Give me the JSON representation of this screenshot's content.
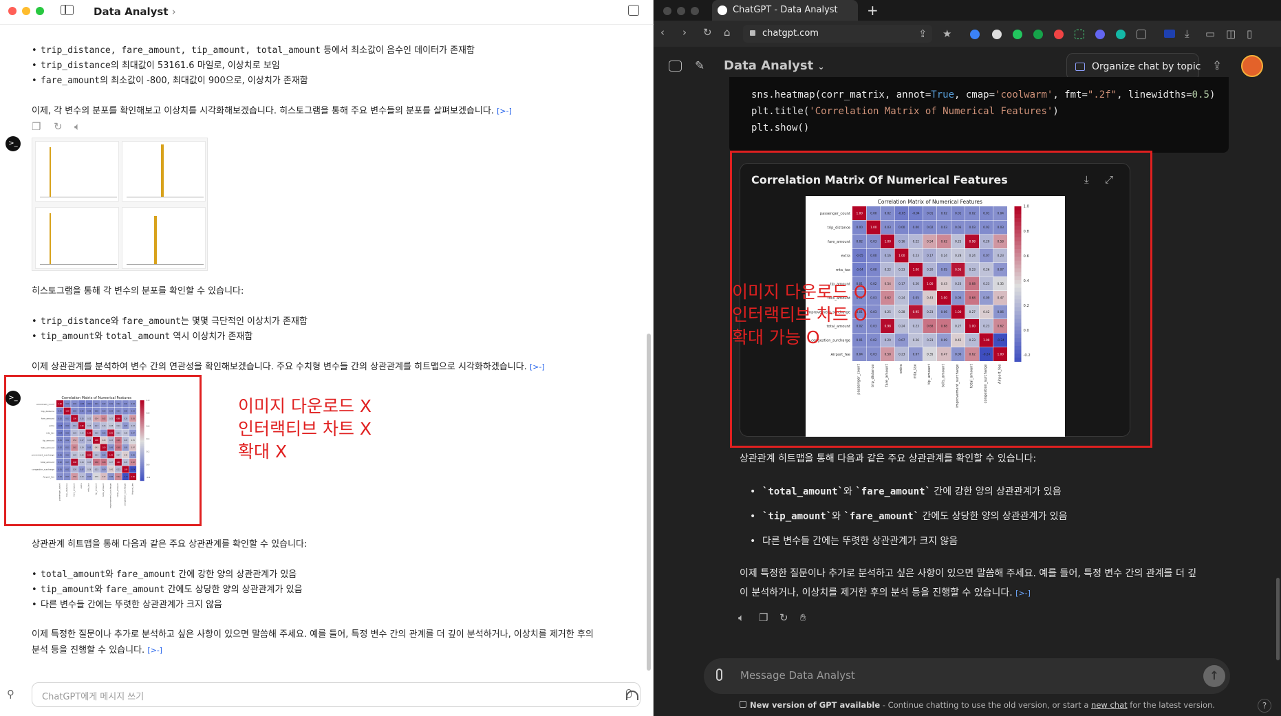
{
  "left": {
    "title": "Data Analyst",
    "title_chevron": "›",
    "bullets_top": [
      {
        "code": "trip_distance, fare_amount, tip_amount, total_amount",
        "text": " 등에서 최소값이 음수인 데이터가 존재함"
      },
      {
        "code": "trip_distance",
        "text": "의 최대값이 53161.6 마일로, 이상치로 보임"
      },
      {
        "code": "fare_amount",
        "text": "의 최소값이 -800, 최대값이 900으로, 이상치가 존재함"
      }
    ],
    "para1": "이제, 각 변수의 분포를 확인해보고 이상치를 시각화해보겠습니다. 히스토그램을 통해 주요 변수들의 분포를 살펴보겠습니다.",
    "cite": "[>-]",
    "hist_caption": "히스토그램을 통해 각 변수의 분포를 확인할 수 있습니다:",
    "bullets_mid": [
      {
        "code": "trip_distance",
        "mid": "와 ",
        "code2": "fare_amount",
        "text": "는 몇몇 극단적인 이상치가 존재함"
      },
      {
        "code": "tip_amount",
        "mid": "와 ",
        "code2": "total_amount",
        "text": " 역시 이상치가 존재함"
      }
    ],
    "para2": "이제 상관관계를 분석하여 변수 간의 연관성을 확인해보겠습니다. 주요 수치형 변수들 간의 상관관계를 히트맵으로 시각화하겠습니다.",
    "annotation": [
      "이미지 다운로드 X",
      "인터랙티브 차트 X",
      "확대 X"
    ],
    "heatmap_caption": "상관관계 히트맵을 통해 다음과 같은 주요 상관관계를 확인할 수 있습니다:",
    "bullets_bottom": [
      {
        "code": "total_amount",
        "mid": "와 ",
        "code2": "fare_amount",
        "text": " 간에 강한 양의 상관관계가 있음"
      },
      {
        "code": "tip_amount",
        "mid": "와 ",
        "code2": "fare_amount",
        "text": " 간에도 상당한 양의 상관관계가 있음"
      },
      {
        "code": "",
        "mid": "",
        "code2": "",
        "text": "다른 변수들 간에는 뚜렷한 상관관계가 크지 않음"
      }
    ],
    "closing_1": "이제 특정한 질문이나 추가로 분석하고 싶은 사항이 있으면 말씀해 주세요. 예를 들어, 특정 변수 간의 관계를 더 깊이 분석하거나, 이상치를 제거한 후의",
    "closing_2": "분석 등을 진행할 수 있습니다.",
    "input_placeholder": "ChatGPT에게 메시지 쓰기",
    "avatar_glyph": ">_"
  },
  "right": {
    "tab_title": "ChatGPT - Data Analyst",
    "new_tab": "+",
    "url": "chatgpt.com",
    "header_title": "Data Analyst",
    "organize_label": "Organize chat by topic",
    "code_line1_pre": "sns.heatmap(corr_matrix, annot=",
    "code_line1_true": "True",
    "code_line1_mid": ", cmap=",
    "code_line1_cmap": "'coolwarm'",
    "code_line1_fmt_pre": ", fmt=",
    "code_line1_fmt": "\".2f\"",
    "code_line1_lw_pre": ", linewidths=",
    "code_line1_lw": "0.5",
    "code_line1_end": ")",
    "code_line2_pre": "plt.title(",
    "code_line2_str": "'Correlation Matrix of Numerical Features'",
    "code_line2_end": ")",
    "code_line3": "plt.show()",
    "card_title": "Correlation Matrix Of Numerical Features",
    "annotation": [
      "이미지 다운로드 O",
      "인터랙티브 차트 O",
      "확대 가능 O"
    ],
    "caption": "상관관계 히트맵을 통해 다음과 같은 주요 상관관계를 확인할 수 있습니다:",
    "bullets": [
      {
        "code": "`total_amount`",
        "mid": "와 ",
        "code2": "`fare_amount`",
        "text": " 간에 강한 양의 상관관계가 있음"
      },
      {
        "code": "`tip_amount`",
        "mid": "와 ",
        "code2": "`fare_amount`",
        "text": " 간에도 상당한 양의 상관관계가 있음"
      },
      {
        "code": "",
        "mid": "",
        "code2": "",
        "text": "다른 변수들 간에는 뚜렷한 상관관계가 크지 않음"
      }
    ],
    "closing_1": "이제 특정한 질문이나 추가로 분석하고 싶은 사항이 있으면 말씀해 주세요. 예를 들어, 특정 변수 간의 관계를 더 깊",
    "closing_2": "이 분석하거나, 이상치를 제거한 후의 분석 등을 진행할 수 있습니다.",
    "cite": "[>-]",
    "input_placeholder": "Message Data Analyst",
    "footer_bold": "New version of GPT available",
    "footer_text": " - Continue chatting to use the old version, or start a ",
    "footer_link": "new chat",
    "footer_end": " for the latest version.",
    "help": "?"
  },
  "heatmap": {
    "title": "Correlation Matrix of Numerical Features",
    "labels": [
      "passenger_count",
      "trip_distance",
      "fare_amount",
      "extra",
      "mta_tax",
      "tip_amount",
      "tolls_amount",
      "improvement_surcharge",
      "total_amount",
      "congestion_surcharge",
      "Airport_fee"
    ],
    "colorbar_ticks": [
      "1.0",
      "0.8",
      "0.6",
      "0.4",
      "0.2",
      "0.0",
      "-0.2"
    ],
    "matrix": [
      [
        1.0,
        -0.0,
        0.02,
        -0.05,
        -0.04,
        0.01,
        0.02,
        0.01,
        0.02,
        0.01,
        0.04
      ],
      [
        -0.0,
        1.0,
        0.03,
        0.0,
        -0.0,
        0.02,
        0.03,
        0.03,
        0.03,
        0.02,
        0.03
      ],
      [
        0.02,
        0.03,
        1.0,
        0.16,
        0.22,
        0.54,
        0.62,
        0.25,
        0.98,
        0.2,
        0.58
      ],
      [
        -0.05,
        0.0,
        0.16,
        1.0,
        0.23,
        0.17,
        0.24,
        0.28,
        0.24,
        0.07,
        0.23
      ],
      [
        -0.04,
        -0.0,
        0.22,
        0.23,
        1.0,
        0.2,
        0.05,
        0.95,
        0.23,
        0.26,
        0.07
      ],
      [
        0.01,
        0.02,
        0.54,
        0.17,
        0.2,
        1.0,
        0.43,
        0.23,
        0.68,
        0.23,
        0.35
      ],
      [
        0.02,
        0.03,
        0.62,
        0.24,
        0.05,
        0.43,
        1.0,
        0.06,
        0.68,
        0.09,
        0.47
      ],
      [
        0.01,
        0.03,
        0.25,
        0.28,
        0.95,
        0.23,
        0.06,
        1.0,
        0.27,
        0.42,
        0.06
      ],
      [
        0.02,
        0.03,
        0.98,
        0.24,
        0.23,
        0.68,
        0.68,
        0.27,
        1.0,
        0.23,
        0.62
      ],
      [
        0.01,
        0.02,
        0.2,
        0.07,
        0.26,
        0.23,
        0.09,
        0.42,
        0.23,
        1.0,
        -0.24
      ],
      [
        0.04,
        0.03,
        0.58,
        0.23,
        0.07,
        0.35,
        0.47,
        0.06,
        0.62,
        -0.24,
        1.0
      ]
    ]
  }
}
